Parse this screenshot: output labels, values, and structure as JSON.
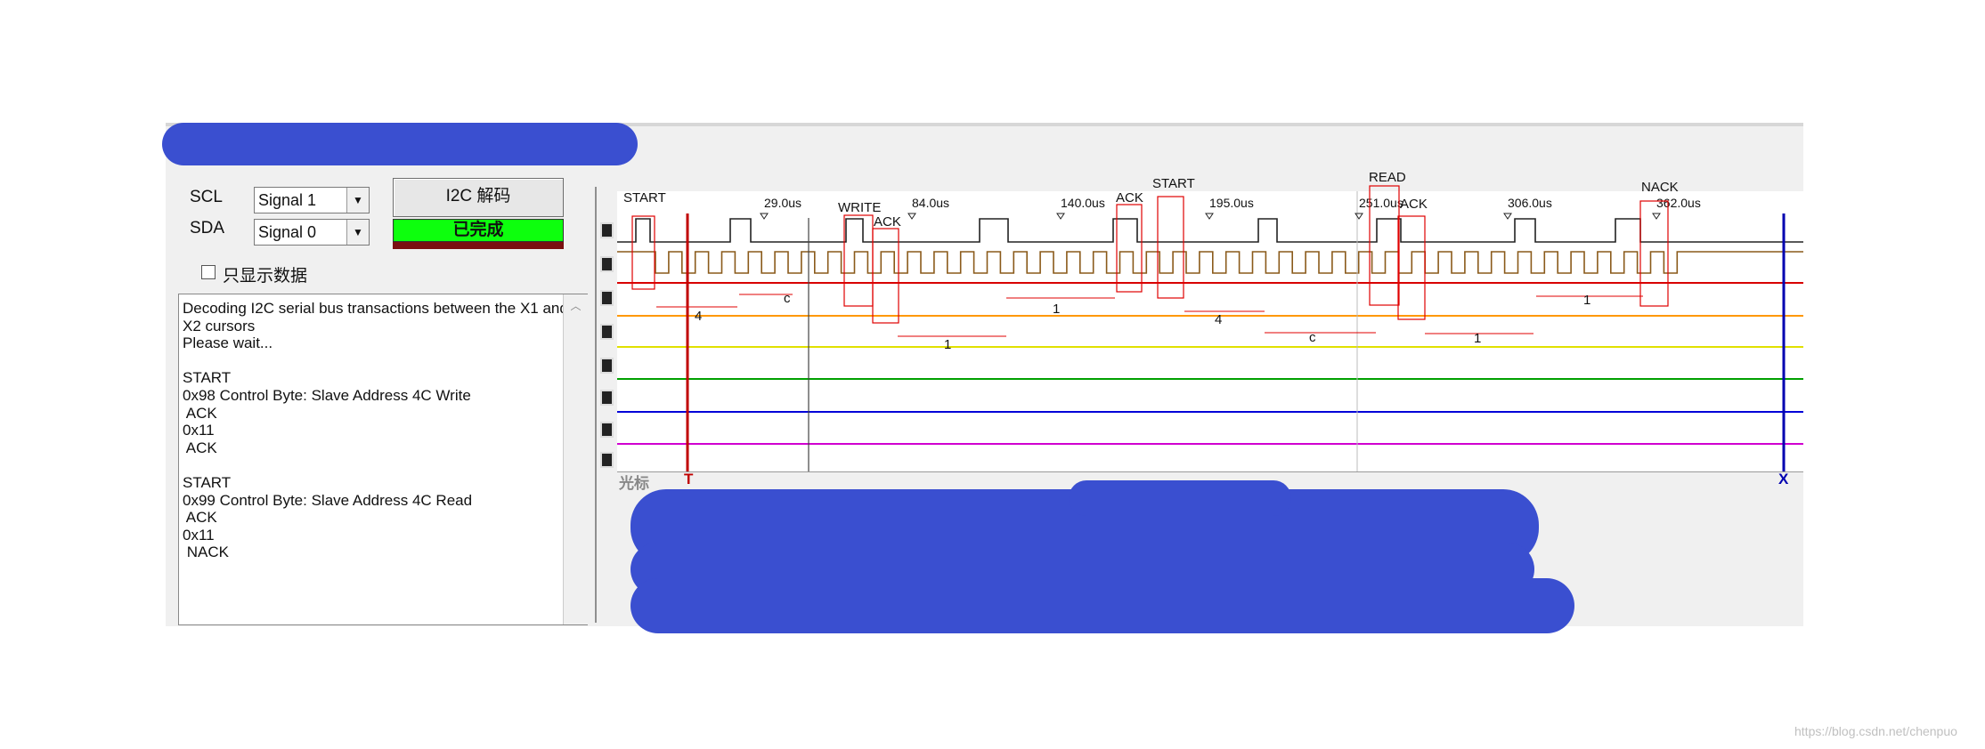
{
  "panel": {
    "scl_label": "SCL",
    "sda_label": "SDA",
    "scl_value": "Signal 1",
    "sda_value": "Signal 0",
    "decode_button": "I2C 解码",
    "status_text": "已完成",
    "data_only_checkbox": "只显示数据"
  },
  "log_lines": [
    "Decoding I2C serial bus transactions between the X1 and",
    "X2 cursors",
    "Please wait...",
    "",
    "START",
    "0x98 Control Byte: Slave Address 4C Write",
    " ACK",
    "0x11",
    " ACK",
    "",
    "START",
    "0x99 Control Byte: Slave Address 4C Read",
    " ACK",
    "0x11",
    " NACK"
  ],
  "time_markers": [
    "29.0us",
    "84.0us",
    "140.0us",
    "195.0us",
    "251.0us",
    "306.0us",
    "362.0us"
  ],
  "annotations": {
    "start1": "START",
    "write": "WRITE",
    "ack1": "ACK",
    "ack2": "ACK",
    "start2": "START",
    "read": "READ",
    "ack3": "ACK",
    "nack": "NACK"
  },
  "bit_labels": [
    "4",
    "c",
    "1",
    "1",
    "4",
    "c",
    "1",
    "1"
  ],
  "cursor": {
    "label": "光标",
    "t": "T",
    "x": "X"
  },
  "watermark": "https://blog.csdn.net/chenpuo",
  "colors": {
    "status_green": "#0dff0d",
    "scribble_blue": "#3a4fd0",
    "cursor_t": "#c00000",
    "cursor_x": "#0000b0",
    "annotation_red": "#e00000"
  }
}
